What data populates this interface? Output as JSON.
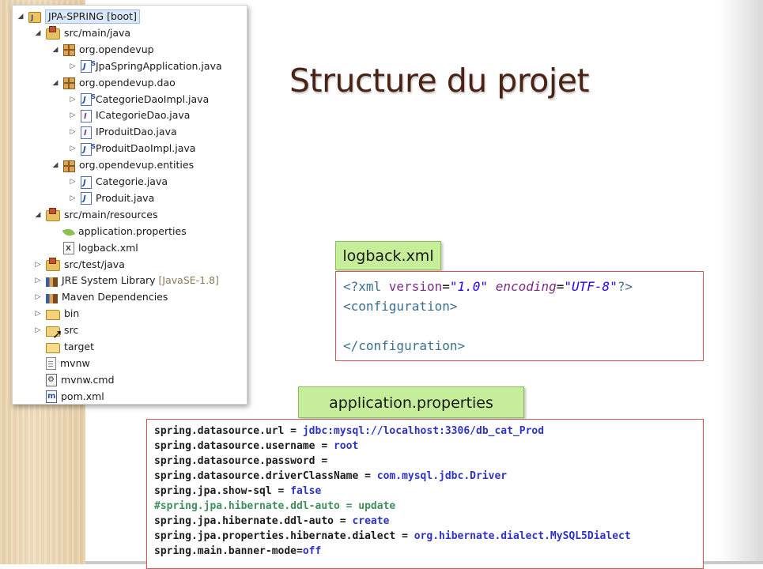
{
  "slide": {
    "title": "Structure du projet"
  },
  "explorer": {
    "items": [
      {
        "label": "JPA-SPRING [boot]",
        "arrow": "◢",
        "icon": "project-icon",
        "depth": 0,
        "selected": true
      },
      {
        "label": "src/main/java",
        "arrow": "◢",
        "icon": "source-folder-icon",
        "depth": 1
      },
      {
        "label": "org.opendevup",
        "arrow": "◢",
        "icon": "package-icon",
        "depth": 2
      },
      {
        "label": "JpaSpringApplication.java",
        "arrow": "▷",
        "icon": "java-spring-file-icon",
        "depth": 3
      },
      {
        "label": "org.opendevup.dao",
        "arrow": "◢",
        "icon": "package-icon",
        "depth": 2
      },
      {
        "label": "CategorieDaoImpl.java",
        "arrow": "▷",
        "icon": "java-spring-file-icon",
        "depth": 3
      },
      {
        "label": "ICategorieDao.java",
        "arrow": "▷",
        "icon": "java-interface-icon",
        "depth": 3
      },
      {
        "label": "IProduitDao.java",
        "arrow": "▷",
        "icon": "java-interface-icon",
        "depth": 3
      },
      {
        "label": "ProduitDaoImpl.java",
        "arrow": "▷",
        "icon": "java-spring-file-icon",
        "depth": 3
      },
      {
        "label": "org.opendevup.entities",
        "arrow": "◢",
        "icon": "package-icon",
        "depth": 2
      },
      {
        "label": "Categorie.java",
        "arrow": "▷",
        "icon": "java-file-icon",
        "depth": 3
      },
      {
        "label": "Produit.java",
        "arrow": "▷",
        "icon": "java-file-icon",
        "depth": 3
      },
      {
        "label": "src/main/resources",
        "arrow": "◢",
        "icon": "source-folder-icon",
        "depth": 1
      },
      {
        "label": "application.properties",
        "arrow": "",
        "icon": "spring-leaf-icon",
        "depth": 2
      },
      {
        "label": "logback.xml",
        "arrow": "",
        "icon": "xml-file-icon",
        "depth": 2
      },
      {
        "label": "src/test/java",
        "arrow": "▷",
        "icon": "source-folder-icon",
        "depth": 1
      },
      {
        "label": "JRE System Library",
        "suffix": "[JavaSE-1.8]",
        "arrow": "▷",
        "icon": "library-icon",
        "depth": 1
      },
      {
        "label": "Maven Dependencies",
        "arrow": "▷",
        "icon": "library-icon",
        "depth": 1
      },
      {
        "label": "bin",
        "arrow": "▷",
        "icon": "folder-icon",
        "depth": 1
      },
      {
        "label": "src",
        "arrow": "▷",
        "icon": "folder-icon",
        "depth": 1
      },
      {
        "label": "target",
        "arrow": "",
        "icon": "folder-open-icon",
        "depth": 1
      },
      {
        "label": "mvnw",
        "arrow": "",
        "icon": "file-icon",
        "depth": 1
      },
      {
        "label": "mvnw.cmd",
        "arrow": "",
        "icon": "cmd-file-icon",
        "depth": 1
      },
      {
        "label": "pom.xml",
        "arrow": "",
        "icon": "maven-pom-icon",
        "depth": 1
      }
    ]
  },
  "logback": {
    "label": "logback.xml",
    "line1": {
      "open": "<?xml ",
      "attr1": "version",
      "eq1": "=",
      "val1": "\"1.0\"",
      "space": " ",
      "attr2": "encoding",
      "eq2": "=",
      "val2": "\"UTF-8\"",
      "close": "?>"
    },
    "line2": "<configuration>",
    "line3": "",
    "line4": "</configuration>"
  },
  "properties": {
    "label": "application.properties",
    "lines": [
      {
        "key": "spring.datasource.url = ",
        "value": "jdbc:mysql://localhost:3306/db_cat_Prod",
        "comment": false
      },
      {
        "key": "spring.datasource.username = ",
        "value": "root",
        "comment": false
      },
      {
        "key": "spring.datasource.password =",
        "value": "",
        "comment": false
      },
      {
        "key": "spring.datasource.driverClassName = ",
        "value": "com.mysql.jdbc.Driver",
        "comment": false
      },
      {
        "key": "spring.jpa.show-sql = ",
        "value": "false",
        "comment": false
      },
      {
        "key": "#spring.jpa.hibernate.ddl-auto = update",
        "value": "",
        "comment": true
      },
      {
        "key": "spring.jpa.hibernate.ddl-auto = ",
        "value": "create",
        "comment": false
      },
      {
        "key": "spring.jpa.properties.hibernate.dialect = ",
        "value": "org.hibernate.dialect.MySQL5Dialect",
        "comment": false
      },
      {
        "key": "spring.main.banner-mode=",
        "value": "off",
        "comment": false
      }
    ]
  },
  "colors": {
    "title": "#4b2314",
    "label_green": "#c6ed9a",
    "code_border": "#d9534f",
    "prop_value": "#2d33c4",
    "prop_comment": "#3f8f5a"
  }
}
